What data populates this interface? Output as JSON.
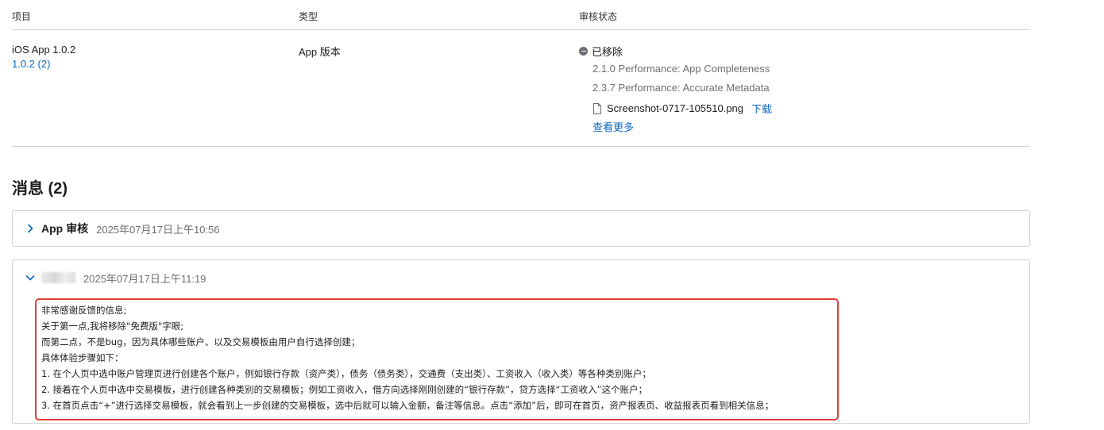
{
  "table": {
    "headers": [
      "项目",
      "类型",
      "审核状态"
    ]
  },
  "row": {
    "item_name": "iOS App 1.0.2",
    "build_link": "1.0.2 (2)",
    "type": "App 版本",
    "status": "已移除",
    "reasons": [
      "2.1.0 Performance: App Completeness",
      "2.3.7 Performance: Accurate Metadata"
    ],
    "attachment": {
      "filename": "Screenshot-0717-105510.png",
      "download_label": "下载"
    },
    "see_more_label": "查看更多"
  },
  "messages": {
    "title": "消息 (2)",
    "items": [
      {
        "sender": "App 审核",
        "date": "2025年07月17日上午10:56",
        "expanded": false
      },
      {
        "sender_redacted": true,
        "date": "2025年07月17日上午11:19",
        "expanded": true,
        "body": [
          "非常感谢反馈的信息;",
          "关于第一点,我将移除\"免费版\"字眼;",
          "而第二点，不是bug，因为具体哪些账户、以及交易模板由用户自行选择创建；",
          "具体体验步骤如下：",
          "1. 在个人页中选中账户管理页进行创建各个账户，例如银行存款（资产类），债务（债务类），交通费（支出类）、工资收入（收入类）等各种类别账户；",
          "2. 接着在个人页中选中交易模板，进行创建各种类别的交易模板；例如工资收入，借方向选择刚刚创建的“银行存款”，贷方选择“工资收入”这个账户；",
          "3. 在首页点击“+”进行选择交易模板，就会看到上一步创建的交易模板，选中后就可以输入金额，备注等信息。点击“添加”后，即可在首页，资产报表页、收益报表页看到相关信息；"
        ]
      }
    ]
  },
  "colors": {
    "link": "#0a66c2",
    "highlight_border": "#e0403a",
    "divider": "#d2d2d7"
  }
}
